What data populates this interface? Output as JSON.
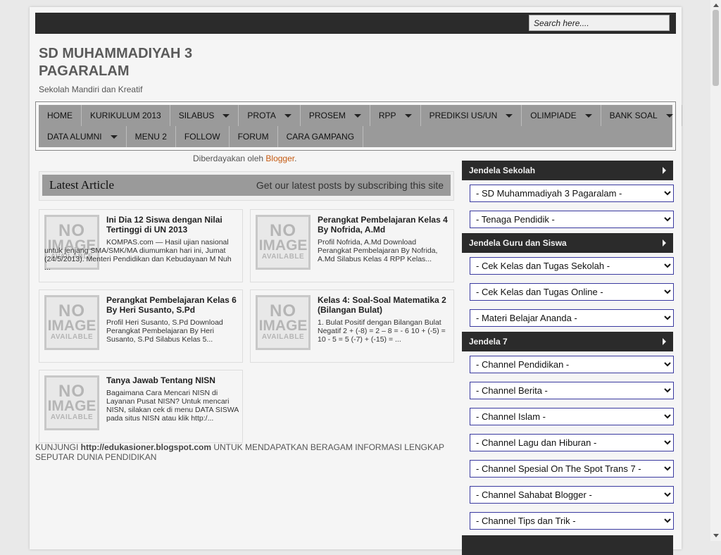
{
  "search": {
    "placeholder": "Search here...."
  },
  "header": {
    "title": "SD MUHAMMADIYAH 3 PAGARALAM",
    "description": "Sekolah Mandiri dan Kreatif"
  },
  "nav": {
    "row1": [
      {
        "label": "HOME",
        "dropdown": false
      },
      {
        "label": "KURIKULUM 2013",
        "dropdown": false
      },
      {
        "label": "SILABUS",
        "dropdown": true
      },
      {
        "label": "PROTA",
        "dropdown": true
      },
      {
        "label": "PROSEM",
        "dropdown": true
      },
      {
        "label": "RPP",
        "dropdown": true
      },
      {
        "label": "PREDIKSI US/UN",
        "dropdown": true
      },
      {
        "label": "OLIMPIADE",
        "dropdown": true
      },
      {
        "label": "BANK SOAL",
        "dropdown": true
      }
    ],
    "row2": [
      {
        "label": "DATA ALUMNI",
        "dropdown": true
      },
      {
        "label": "MENU 2",
        "dropdown": false
      },
      {
        "label": "FOLLOW",
        "dropdown": false
      },
      {
        "label": "FORUM",
        "dropdown": false
      },
      {
        "label": "CARA GAMPANG",
        "dropdown": false
      }
    ]
  },
  "powered": {
    "prefix": "Diberdayakan oleh ",
    "link": "Blogger",
    "suffix": "."
  },
  "latest": {
    "title": "Latest Article",
    "subtitle": "Get our latest posts by subscribing this site"
  },
  "thumb": {
    "no": "NO",
    "image": "IMAGE",
    "available": "AVAILABLE"
  },
  "posts": [
    {
      "title": "Ini Dia 12 Siswa dengan Nilai Tertinggi di UN 2013",
      "excerpt": "KOMPAS.com — Hasil ujian nasional untuk jenjang SMA/SMK/MA diumumkan hari ini, Jumat (24/5/2013). Menteri Pendidikan dan Kebudayaan M Nuh ..."
    },
    {
      "title": "Perangkat Pembelajaran Kelas 4 By Nofrida, A.Md",
      "excerpt": "Profil Nofrida, A.Md     Download Perangkat Pembelajaran By Nofrida, A.Md  Silabus Kelas 4  RPP Kelas..."
    },
    {
      "title": "Perangkat Pembelajaran Kelas 6 By Heri Susanto, S.Pd",
      "excerpt": "Profil Heri Susanto, S.Pd   Download Perangkat Pembelajaran By Heri Susanto, S.Pd  Silabus Kelas 5..."
    },
    {
      "title": "Kelas 4: Soal-Soal Matematika 2 (Bilangan Bulat)",
      "excerpt": "1. Bulat Positif dengan Bilangan Bulat Negatif 2 + (-8) = 2 – 8 = - 6  10 + (-5) = 10 - 5 = 5  (-7) + (-15) = ..."
    },
    {
      "title": "Tanya Jawab Tentang NISN",
      "excerpt": "Bagaimana Cara Mencari NISN di Layanan Pusat NISN?   Untuk mencari NISN, silakan cek di menu DATA SISWA pada situs NISN atau klik http:/..."
    }
  ],
  "footer": {
    "prefix": "KUNJUNGI ",
    "url": "http://edukasioner.blogspot.com",
    "suffix": " UNTUK MENDAPATKAN BERAGAM INFORMASI LENGKAP SEPUTAR DUNIA PENDIDIKAN"
  },
  "sidebar": {
    "widgets": [
      {
        "title": "Jendela Sekolah",
        "selects": [
          "- SD Muhammadiyah 3 Pagaralam -",
          "- Tenaga Pendidik -"
        ]
      },
      {
        "title": "Jendela Guru dan Siswa",
        "selects": [
          "- Cek Kelas dan Tugas Sekolah -",
          "- Cek Kelas dan Tugas Online -",
          "- Materi Belajar Ananda -"
        ]
      },
      {
        "title": "Jendela 7",
        "selects": [
          "- Channel Pendidikan -",
          "- Channel Berita -",
          "- Channel Islam -",
          "- Channel Lagu dan Hiburan -",
          "- Channel Spesial On The Spot Trans 7 -",
          "- Channel Sahabat Blogger -",
          "- Channel Tips dan Trik -"
        ]
      }
    ]
  }
}
